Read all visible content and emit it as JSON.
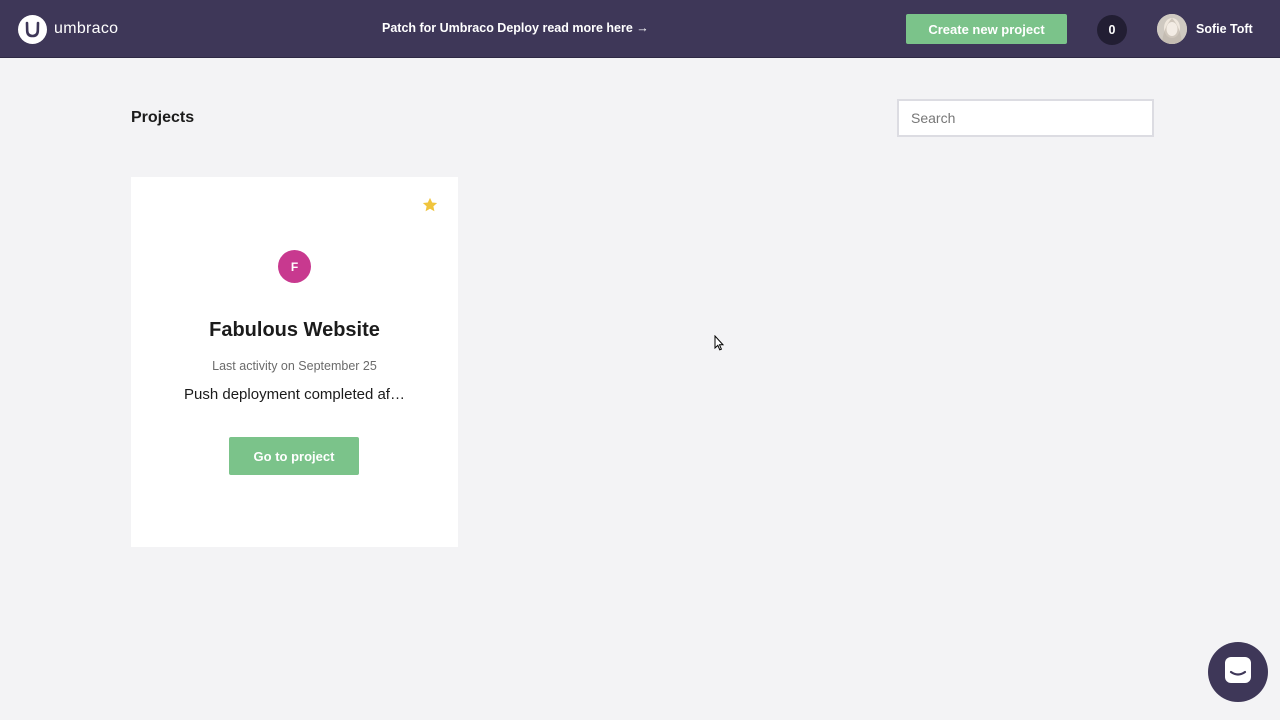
{
  "header": {
    "logo_text": "umbraco",
    "logo_icon": "umbraco-logo-icon",
    "announcement": "Patch for Umbraco Deploy read more here →",
    "create_button": "Create new project",
    "notification_count": "0",
    "user_name": "Sofie Toft",
    "user_avatar_icon": "user-avatar"
  },
  "main": {
    "title": "Projects",
    "search_placeholder": "Search"
  },
  "projects": [
    {
      "initial": "F",
      "initial_color": "#c8398f",
      "name": "Fabulous Website",
      "last_activity": "Last activity on September 25",
      "status": "Push deployment completed af…",
      "button": "Go to project",
      "favorite": true,
      "star_icon": "star-icon"
    }
  ],
  "chat_widget": {
    "icon": "chat-bubble-icon"
  },
  "colors": {
    "header_bg": "#3e3758",
    "accent_green": "#7bc38a",
    "page_bg": "#f3f3f5",
    "star": "#f0c43c"
  }
}
